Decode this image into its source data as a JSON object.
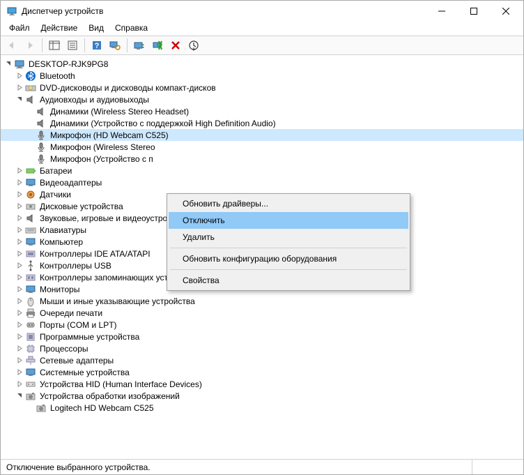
{
  "window": {
    "title": "Диспетчер устройств"
  },
  "menus": {
    "file": "Файл",
    "action": "Действие",
    "view": "Вид",
    "help": "Справка"
  },
  "tree": {
    "root": "DESKTOP-RJK9PG8",
    "bluetooth": "Bluetooth",
    "dvd": "DVD-дисководы и дисководы компакт-дисков",
    "audio": "Аудиовходы и аудиовыходы",
    "audio_children": {
      "speakers_wsh": "Динамики (Wireless Stereo Headset)",
      "speakers_hd": "Динамики (Устройство с поддержкой High Definition Audio)",
      "mic_hd_webcam": "Микрофон (HD Webcam C525)",
      "mic_wsh": "Микрофон (Wireless Stereo",
      "mic_hd": "Микрофон (Устройство с п"
    },
    "batteries": "Батареи",
    "display": "Видеоадаптеры",
    "sensors": "Датчики",
    "disk": "Дисковые устройства",
    "sound_game": "Звуковые, игровые и видеоустройства",
    "keyboards": "Клавиатуры",
    "computer": "Компьютер",
    "ide": "Контроллеры IDE ATA/ATAPI",
    "usb": "Контроллеры USB",
    "storage_ctrl": "Контроллеры запоминающих устройств",
    "monitors": "Мониторы",
    "mice": "Мыши и иные указывающие устройства",
    "print_queues": "Очереди печати",
    "ports": "Порты (COM и LPT)",
    "software": "Программные устройства",
    "processors": "Процессоры",
    "network": "Сетевые адаптеры",
    "system": "Системные устройства",
    "hid": "Устройства HID (Human Interface Devices)",
    "imaging": "Устройства обработки изображений",
    "imaging_children": {
      "webcam": "Logitech HD Webcam C525"
    }
  },
  "context_menu": {
    "update_drivers": "Обновить драйверы...",
    "disable": "Отключить",
    "uninstall": "Удалить",
    "scan": "Обновить конфигурацию оборудования",
    "properties": "Свойства"
  },
  "statusbar": {
    "text": "Отключение выбранного устройства."
  }
}
